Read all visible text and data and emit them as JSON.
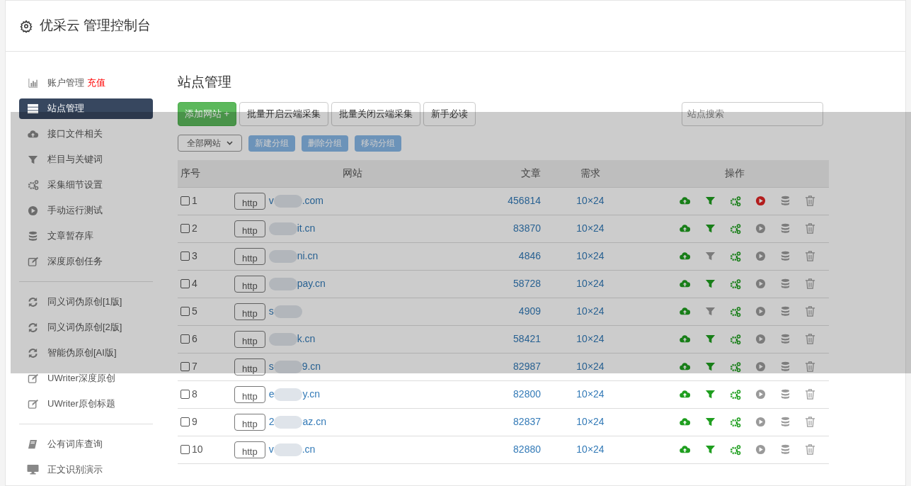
{
  "header": {
    "title": "优采云 管理控制台"
  },
  "sidebar": {
    "groups": [
      [
        {
          "kind": "chart",
          "label": "账户管理",
          "badge": "充值",
          "selected": false
        },
        {
          "kind": "server",
          "label": "站点管理",
          "selected": true
        },
        {
          "kind": "cloud",
          "label": "接口文件相关",
          "selected": false
        },
        {
          "kind": "filter",
          "label": "栏目与关键词",
          "selected": false
        },
        {
          "kind": "gears",
          "label": "采集细节设置",
          "selected": false
        },
        {
          "kind": "play",
          "label": "手动运行测试",
          "selected": false
        },
        {
          "kind": "database",
          "label": "文章暂存库",
          "selected": false
        },
        {
          "kind": "edit",
          "label": "深度原创任务",
          "selected": false
        }
      ],
      [
        {
          "kind": "refresh",
          "label": "同义词伪原创[1版]",
          "selected": false
        },
        {
          "kind": "refresh",
          "label": "同义词伪原创[2版]",
          "selected": false
        },
        {
          "kind": "refresh",
          "label": "智能伪原创[AI版]",
          "selected": false
        },
        {
          "kind": "edit",
          "label": "UWriter深度原创",
          "selected": false
        },
        {
          "kind": "edit",
          "label": "UWriter原创标题",
          "selected": false
        }
      ],
      [
        {
          "kind": "book",
          "label": "公有词库查询",
          "selected": false
        },
        {
          "kind": "monitor",
          "label": "正文识别演示",
          "selected": false
        }
      ]
    ]
  },
  "main": {
    "title": "站点管理",
    "toolbar": [
      {
        "label": "添加网站 +",
        "kind": "primary"
      },
      {
        "label": "批量开启云端采集",
        "kind": "default"
      },
      {
        "label": "批量关闭云端采集",
        "kind": "default"
      },
      {
        "label": "新手必读",
        "kind": "default"
      }
    ],
    "search": {
      "placeholder": "站点搜索"
    },
    "group_select": {
      "value": "全部网站"
    },
    "group_buttons": [
      "新建分组",
      "删除分组",
      "移动分组"
    ],
    "table": {
      "columns": [
        "序号",
        "网站",
        "文章",
        "需求",
        "操作"
      ],
      "rows": [
        {
          "checked": false,
          "index": "1",
          "protocol": "http",
          "site_start": "v",
          "site_end": ".com",
          "articles": "456814",
          "demand": "10×24",
          "filter_on": true,
          "running": true
        },
        {
          "checked": false,
          "index": "2",
          "protocol": "http",
          "site_start": "",
          "site_end": "it.cn",
          "articles": "83870",
          "demand": "10×24",
          "filter_on": true,
          "running": false
        },
        {
          "checked": false,
          "index": "3",
          "protocol": "http",
          "site_start": "",
          "site_end": "ni.cn",
          "articles": "4846",
          "demand": "10×24",
          "filter_on": false,
          "running": false
        },
        {
          "checked": false,
          "index": "4",
          "protocol": "http",
          "site_start": "",
          "site_end": "pay.cn",
          "articles": "58728",
          "demand": "10×24",
          "filter_on": true,
          "running": false
        },
        {
          "checked": false,
          "index": "5",
          "protocol": "http",
          "site_start": "s",
          "site_end": "",
          "articles": "4909",
          "demand": "10×24",
          "filter_on": false,
          "running": false
        },
        {
          "checked": false,
          "index": "6",
          "protocol": "http",
          "site_start": "",
          "site_end": "k.cn",
          "articles": "58421",
          "demand": "10×24",
          "filter_on": true,
          "running": false
        },
        {
          "checked": false,
          "index": "7",
          "protocol": "http",
          "site_start": "s",
          "site_end": "9.cn",
          "articles": "82987",
          "demand": "10×24",
          "filter_on": true,
          "running": false
        },
        {
          "checked": false,
          "index": "8",
          "protocol": "http",
          "site_start": "e",
          "site_end": "y.cn",
          "articles": "82800",
          "demand": "10×24",
          "filter_on": true,
          "running": false
        },
        {
          "checked": false,
          "index": "9",
          "protocol": "http",
          "site_start": "2",
          "site_end": "az.cn",
          "articles": "82837",
          "demand": "10×24",
          "filter_on": true,
          "running": false
        },
        {
          "checked": false,
          "index": "10",
          "protocol": "http",
          "site_start": "v",
          "site_end": ".cn",
          "articles": "82880",
          "demand": "10×24",
          "filter_on": true,
          "running": false
        }
      ]
    }
  }
}
